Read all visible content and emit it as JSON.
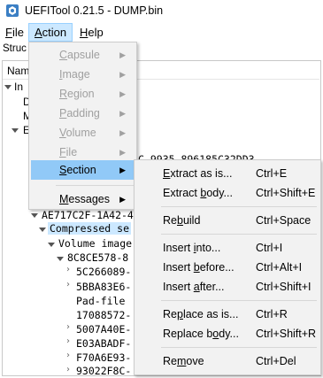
{
  "window": {
    "title": "UEFITool 0.21.5 - DUMP.bin"
  },
  "menubar": [
    {
      "key": "F",
      "rest": "ile"
    },
    {
      "key": "A",
      "rest": "ction"
    },
    {
      "key": "H",
      "rest": "elp"
    }
  ],
  "background": {
    "structure_label": "Struc",
    "name_header": "Nam",
    "rows": [
      {
        "text": "In",
        "mono": false
      },
      {
        "text": "D",
        "mono": false
      },
      {
        "text": "M",
        "mono": false
      },
      {
        "text": "E",
        "mono": false
      },
      {
        "text": "C-9935-896185C32DD3",
        "mono": true
      },
      {
        "text": "AE717C2F-1A42-4",
        "mono": true
      },
      {
        "text": "Compressed se",
        "mono": true
      },
      {
        "text": "Volume image",
        "mono": true
      },
      {
        "text": "8C8CE578-8",
        "mono": true
      },
      {
        "text": "5C266089-",
        "mono": true
      },
      {
        "text": "5BBA83E6-",
        "mono": true
      },
      {
        "text": "Pad-file",
        "mono": true
      },
      {
        "text": "17088572-",
        "mono": true
      },
      {
        "text": "5007A40E-",
        "mono": true
      },
      {
        "text": "E03ABADF-",
        "mono": true
      },
      {
        "text": "F70A6E93-",
        "mono": true
      },
      {
        "text": "93022F8C-",
        "mono": true
      }
    ]
  },
  "action_menu": {
    "items": [
      {
        "pre": "",
        "key": "C",
        "post": "apsule",
        "disabled": true,
        "submenu": true
      },
      {
        "pre": "",
        "key": "I",
        "post": "mage",
        "disabled": true,
        "submenu": true
      },
      {
        "pre": "",
        "key": "R",
        "post": "egion",
        "disabled": true,
        "submenu": true
      },
      {
        "pre": "",
        "key": "P",
        "post": "adding",
        "disabled": true,
        "submenu": true
      },
      {
        "pre": "",
        "key": "V",
        "post": "olume",
        "disabled": true,
        "submenu": true
      },
      {
        "pre": "",
        "key": "F",
        "post": "ile",
        "disabled": true,
        "submenu": true
      },
      {
        "pre": "",
        "key": "S",
        "post": "ection",
        "disabled": false,
        "submenu": true,
        "highlighted": true
      },
      {
        "pre": "",
        "key": "M",
        "post": "essages",
        "disabled": false,
        "submenu": true
      }
    ]
  },
  "section_submenu": {
    "items": [
      {
        "pre": "",
        "key": "E",
        "post": "xtract as is...",
        "shortcut": "Ctrl+E"
      },
      {
        "pre": "Extract ",
        "key": "b",
        "post": "ody...",
        "shortcut": "Ctrl+Shift+E"
      },
      {
        "pre": "Re",
        "key": "b",
        "post": "uild",
        "shortcut": "Ctrl+Space"
      },
      {
        "pre": "Insert ",
        "key": "i",
        "post": "nto...",
        "shortcut": "Ctrl+I"
      },
      {
        "pre": "Insert ",
        "key": "b",
        "post": "efore...",
        "shortcut": "Ctrl+Alt+I"
      },
      {
        "pre": "Insert ",
        "key": "a",
        "post": "fter...",
        "shortcut": "Ctrl+Shift+I"
      },
      {
        "pre": "Re",
        "key": "p",
        "post": "lace as is...",
        "shortcut": "Ctrl+R"
      },
      {
        "pre": "Replace b",
        "key": "o",
        "post": "dy...",
        "shortcut": "Ctrl+Shift+R"
      },
      {
        "pre": "Re",
        "key": "m",
        "post": "ove",
        "shortcut": "Ctrl+Del"
      }
    ]
  },
  "colors": {
    "menu_highlight": "#91c9f7",
    "menubar_active": "#cce8ff",
    "menu_background": "#f2f2f2",
    "disabled_text": "#a0a0a0"
  }
}
